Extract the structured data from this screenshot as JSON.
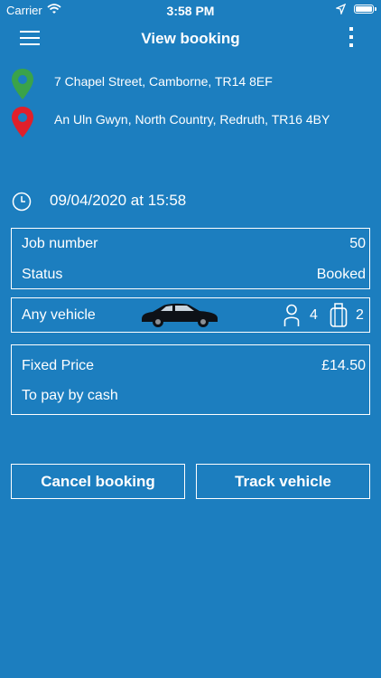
{
  "status_bar": {
    "carrier": "Carrier",
    "time": "3:58 PM"
  },
  "nav": {
    "title": "View booking"
  },
  "addresses": {
    "pickup": "7 Chapel Street, Camborne, TR14 8EF",
    "dropoff": "An Uln Gwyn, North Country, Redruth, TR16 4BY"
  },
  "datetime": "09/04/2020 at 15:58",
  "job": {
    "number_label": "Job number",
    "number_value": "50",
    "status_label": "Status",
    "status_value": "Booked"
  },
  "vehicle": {
    "label": "Any vehicle",
    "passengers": "4",
    "luggage": "2"
  },
  "price": {
    "label": "Fixed Price",
    "value": "£14.50",
    "payment": "To pay by cash"
  },
  "actions": {
    "cancel": "Cancel booking",
    "track": "Track vehicle"
  },
  "colors": {
    "background": "#1c7ebf",
    "pickup_pin": "#3aa34a",
    "dropoff_pin": "#e0202a"
  }
}
